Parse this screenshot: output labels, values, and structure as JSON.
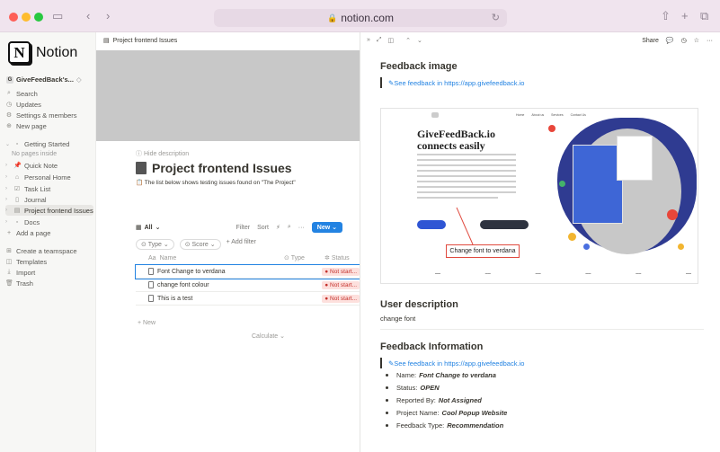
{
  "browser": {
    "url": "notion.com"
  },
  "sidebar": {
    "brand": "Notion",
    "brand_mark": "N",
    "workspace": "GiveFeedBack's...",
    "workspace_badge": "G",
    "items": [
      {
        "label": "Search",
        "icon": "search-icon"
      },
      {
        "label": "Updates",
        "icon": "clock-icon"
      },
      {
        "label": "Settings & members",
        "icon": "gear-icon"
      },
      {
        "label": "New page",
        "icon": "plus-circle-icon"
      }
    ],
    "pages": [
      {
        "label": "Getting Started"
      },
      {
        "label": "No pages inside"
      },
      {
        "label": "Quick Note"
      },
      {
        "label": "Personal Home"
      },
      {
        "label": "Task List"
      },
      {
        "label": "Journal"
      },
      {
        "label": "Project frontend Issues"
      },
      {
        "label": "Docs"
      },
      {
        "label": "Add a page"
      }
    ],
    "footer": [
      {
        "label": "Create a teamspace"
      },
      {
        "label": "Templates"
      },
      {
        "label": "Import"
      },
      {
        "label": "Trash"
      }
    ]
  },
  "main": {
    "breadcrumb": "Project frontend Issues",
    "hide_description": "Hide description",
    "title": "Project frontend Issues",
    "description": "The list below shows testing issues found on \"The Project\"",
    "view_label": "All",
    "toolbar": {
      "filter": "Filter",
      "sort": "Sort",
      "new": "New"
    },
    "chips": {
      "type": "Type",
      "score": "Score",
      "add_filter": "+ Add filter"
    },
    "columns": {
      "name": "Name",
      "type": "Type",
      "status": "Status"
    },
    "rows": [
      {
        "name": "Font Change to verdana",
        "status": "Not start..."
      },
      {
        "name": "change font colour",
        "status": "Not start..."
      },
      {
        "name": "This is a test",
        "status": "Not start..."
      }
    ],
    "new_row": "+ New",
    "calculate": "Calculate"
  },
  "panel": {
    "share": "Share",
    "feedback_image_heading": "Feedback image",
    "feedback_link": "See feedback in https://app.givefeedback.io",
    "shot": {
      "title": "GiveFeedBack.io connects easily",
      "nav": [
        "Home",
        "About us",
        "Services",
        "Contact Us"
      ],
      "callout": "Change font to verdana"
    },
    "user_description_heading": "User description",
    "user_description": "change font",
    "feedback_info_heading": "Feedback Information",
    "feedback_info_link": "See feedback in https://app.givefeedback.io",
    "info": [
      {
        "label": "Name:",
        "value": "Font Change to verdana"
      },
      {
        "label": "Status:",
        "value": "OPEN"
      },
      {
        "label": "Reported By:",
        "value": "Not Assigned"
      },
      {
        "label": "Project Name:",
        "value": "Cool Popup Website"
      },
      {
        "label": "Feedback Type:",
        "value": "Recommendation"
      }
    ]
  }
}
